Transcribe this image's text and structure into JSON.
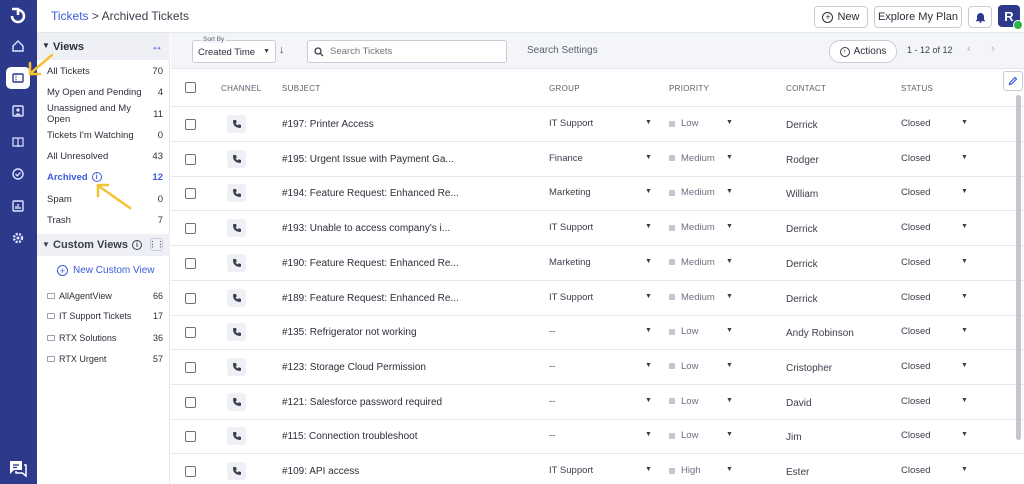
{
  "breadcrumb": {
    "root": "Tickets",
    "separator": " > ",
    "current": "Archived Tickets"
  },
  "header": {
    "new_label": "New",
    "explore_label": "Explore My Plan",
    "avatar_initial": "R"
  },
  "views": {
    "title": "Views",
    "items": [
      {
        "label": "All Tickets",
        "count": "70"
      },
      {
        "label": "My Open and Pending",
        "count": "4"
      },
      {
        "label": "Unassigned and My Open",
        "count": "11"
      },
      {
        "label": "Tickets I'm Watching",
        "count": "0"
      },
      {
        "label": "All Unresolved",
        "count": "43"
      },
      {
        "label": "Archived",
        "count": "12"
      },
      {
        "label": "Spam",
        "count": "0"
      },
      {
        "label": "Trash",
        "count": "7"
      }
    ],
    "custom_title": "Custom Views",
    "new_custom_view": "New Custom View",
    "custom_items": [
      {
        "label": "AllAgentView",
        "count": "66"
      },
      {
        "label": "IT Support Tickets",
        "count": "17"
      },
      {
        "label": "RTX Solutions",
        "count": "36"
      },
      {
        "label": "RTX Urgent",
        "count": "57"
      }
    ]
  },
  "toolbar": {
    "sort_label": "Sort By",
    "sort_value": "Created Time",
    "search_placeholder": "Search Tickets",
    "search_settings": "Search Settings",
    "actions_label": "Actions",
    "pager": "1 - 12 of 12"
  },
  "table": {
    "headers": {
      "channel": "CHANNEL",
      "subject": "SUBJECT",
      "group": "GROUP",
      "priority": "PRIORITY",
      "contact": "CONTACT",
      "status": "STATUS"
    },
    "rows": [
      {
        "subject": "#197: Printer Access",
        "group": "IT Support",
        "priority": "Low",
        "contact": "Derrick",
        "status": "Closed"
      },
      {
        "subject": "#195: Urgent Issue with Payment Ga...",
        "group": "Finance",
        "priority": "Medium",
        "contact": "Rodger",
        "status": "Closed"
      },
      {
        "subject": "#194: Feature Request: Enhanced Re...",
        "group": "Marketing",
        "priority": "Medium",
        "contact": "William",
        "status": "Closed"
      },
      {
        "subject": "#193: Unable to access company's i...",
        "group": "IT Support",
        "priority": "Medium",
        "contact": "Derrick",
        "status": "Closed"
      },
      {
        "subject": "#190: Feature Request: Enhanced Re...",
        "group": "Marketing",
        "priority": "Medium",
        "contact": "Derrick",
        "status": "Closed"
      },
      {
        "subject": "#189: Feature Request: Enhanced Re...",
        "group": "IT Support",
        "priority": "Medium",
        "contact": "Derrick",
        "status": "Closed"
      },
      {
        "subject": "#135: Refrigerator not working",
        "group": "--",
        "priority": "Low",
        "contact": "Andy Robinson",
        "status": "Closed"
      },
      {
        "subject": "#123: Storage Cloud Permission",
        "group": "--",
        "priority": "Low",
        "contact": "Cristopher",
        "status": "Closed"
      },
      {
        "subject": "#121: Salesforce password required",
        "group": "--",
        "priority": "Low",
        "contact": "David",
        "status": "Closed"
      },
      {
        "subject": "#115: Connection troubleshoot",
        "group": "--",
        "priority": "Low",
        "contact": "Jim",
        "status": "Closed"
      },
      {
        "subject": "#109: API access",
        "group": "IT Support",
        "priority": "High",
        "contact": "Ester",
        "status": "Closed"
      }
    ]
  },
  "colors": {
    "rail": "#2d3a8c",
    "accent": "#3b5bdb",
    "annotation_arrow": "#f2c230"
  }
}
